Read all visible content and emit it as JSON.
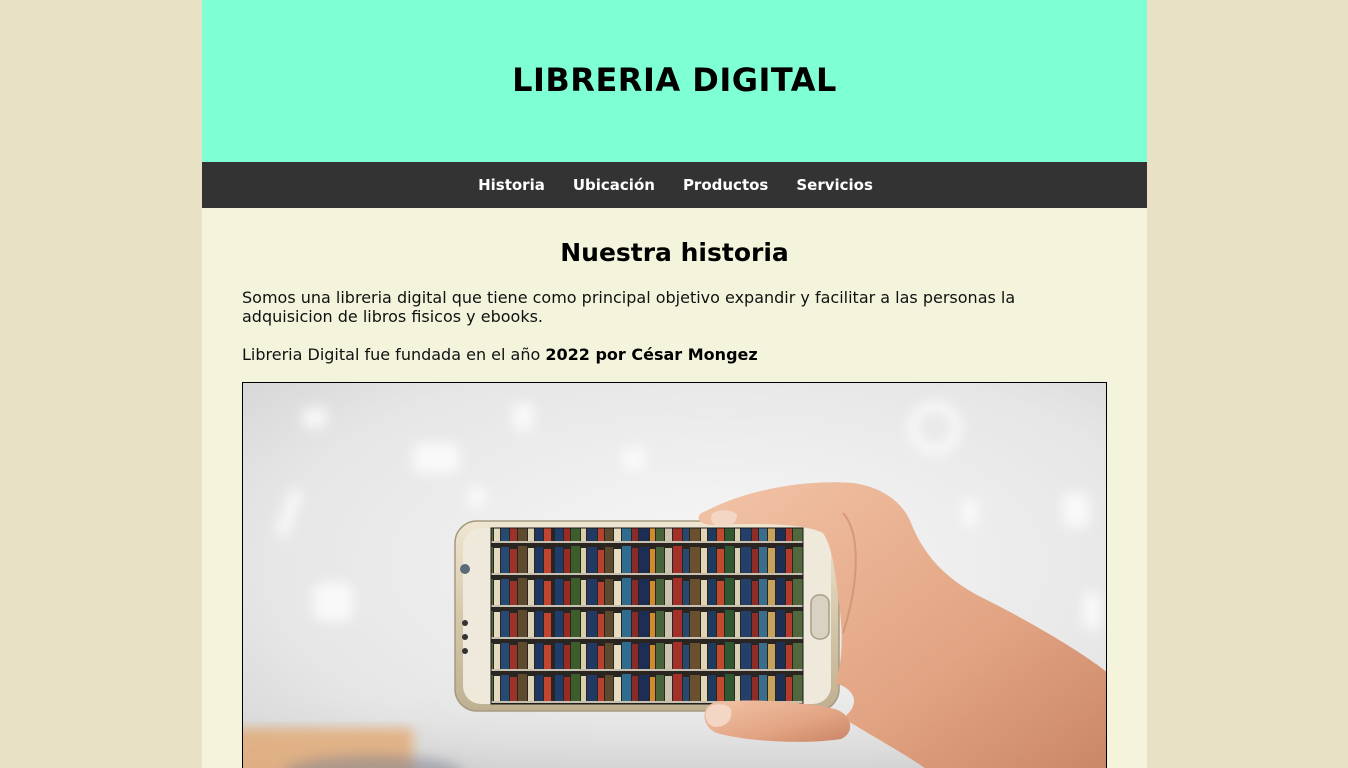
{
  "header": {
    "title": "LIBRERIA DIGITAL"
  },
  "nav": {
    "items": [
      {
        "label": "Historia"
      },
      {
        "label": "Ubicación"
      },
      {
        "label": "Productos"
      },
      {
        "label": "Servicios"
      }
    ]
  },
  "main": {
    "heading": "Nuestra historia",
    "intro": "Somos una libreria digital que tiene como principal objetivo expandir y facilitar a las personas la adquisicion de libros fisicos y ebooks.",
    "founded_prefix": "Libreria Digital fue fundada en el año ",
    "founded_bold": "2022 por César Mongez"
  },
  "colors": {
    "page_bg": "#e8e1c6",
    "content_bg": "#f4f4dc",
    "header_bg": "#7fffd4",
    "nav_bg": "#333333"
  }
}
